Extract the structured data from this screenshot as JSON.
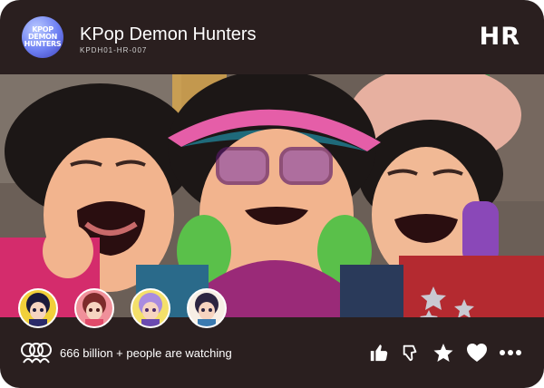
{
  "header": {
    "logo_text": [
      "KPOP",
      "DEMON",
      "HUNTERS"
    ],
    "title": "KPop Demon Hunters",
    "code": "KPDH01-HR-007",
    "rarity": "HR"
  },
  "scene": {
    "description_icon": "three-laughing-ladies-illustration"
  },
  "avatars": [
    {
      "name": "avatar-1",
      "bg": "#f1d03a",
      "hair": "#1b1a3a"
    },
    {
      "name": "avatar-2",
      "bg": "#f0909a",
      "hair": "#7d2b2b"
    },
    {
      "name": "avatar-3",
      "bg": "#f4e06a",
      "hair": "#a98ce0"
    },
    {
      "name": "avatar-4",
      "bg": "#f7efe5",
      "hair": "#2c2540"
    }
  ],
  "footer": {
    "watching_text": "666 billion + people are watching",
    "actions": [
      "thumbs-up-icon",
      "thumbs-down-icon",
      "star-icon",
      "heart-icon",
      "more-icon"
    ]
  },
  "colors": {
    "card": "#2a1f1f",
    "accent_blue": "#6d7ff2",
    "icon_fill": "#ffffff"
  }
}
